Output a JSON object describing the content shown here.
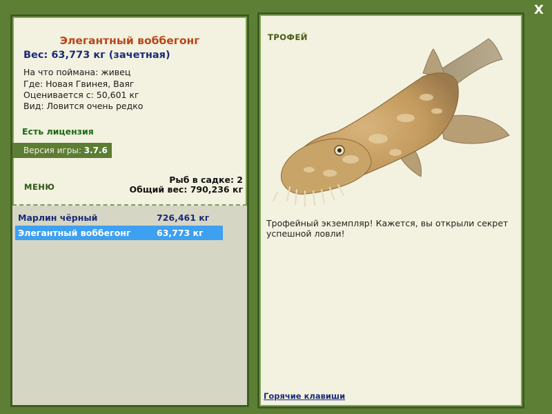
{
  "window": {
    "close_label": "X"
  },
  "fish": {
    "title": "Элегантный воббегонг",
    "weight": "Вес: 63,773 кг (зачетная)",
    "info": [
      "На что поймана: живец",
      "Где: Новая Гвинея, Ваяг",
      "Оценивается с: 50,601 кг",
      "Вид: Ловится очень редко"
    ]
  },
  "license": "Есть лицензия",
  "version": {
    "label": "Версия игры: ",
    "value": "3.7.6"
  },
  "menu_label": "МЕНЮ",
  "keepnet": {
    "count": "Рыб в садке: 2",
    "total": "Общий вес: 790,236 кг",
    "items": [
      {
        "name": "Марлин чёрный",
        "weight": "726,461 кг",
        "selected": false
      },
      {
        "name": "Элегантный воббегонг",
        "weight": "63,773 кг",
        "selected": true
      }
    ]
  },
  "trophy": {
    "label": "ТРОФЕЙ",
    "text": "Трофейный экземпляр! Кажется, вы открыли секрет успешной ловли!",
    "image_icon": "wobbegong-shark-image"
  },
  "hotkeys_label": "Горячие клавиши",
  "colors": {
    "background": "#5d7f35",
    "panel": "#f3f1df",
    "title": "#b8451a",
    "accent_blue": "#1a2b7a",
    "selection": "#3da0f0"
  }
}
